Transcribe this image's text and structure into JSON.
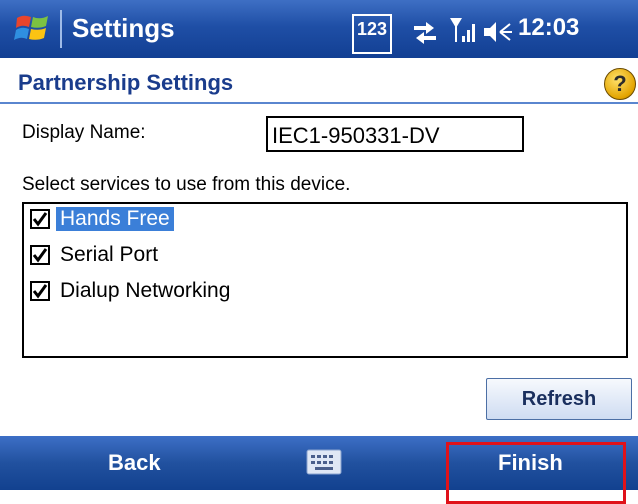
{
  "title_bar": {
    "app_title": "Settings",
    "input_mode": "123",
    "time": "12:03"
  },
  "header": {
    "title": "Partnership Settings",
    "help_icon": "?"
  },
  "form": {
    "display_name_label": "Display Name:",
    "display_name_value": "IEC1-950331-DV",
    "services_prompt": "Select services to use from this device."
  },
  "services": [
    {
      "label": "Hands Free",
      "checked": true,
      "selected": true
    },
    {
      "label": "Serial Port",
      "checked": true,
      "selected": false
    },
    {
      "label": "Dialup Networking",
      "checked": true,
      "selected": false
    }
  ],
  "buttons": {
    "refresh": "Refresh"
  },
  "menu_bar": {
    "left_softkey": "Back",
    "right_softkey": "Finish"
  },
  "colors": {
    "titlebar": "#1f4fa6",
    "selection": "#3b7fd8",
    "highlight_box": "#e0121a"
  }
}
